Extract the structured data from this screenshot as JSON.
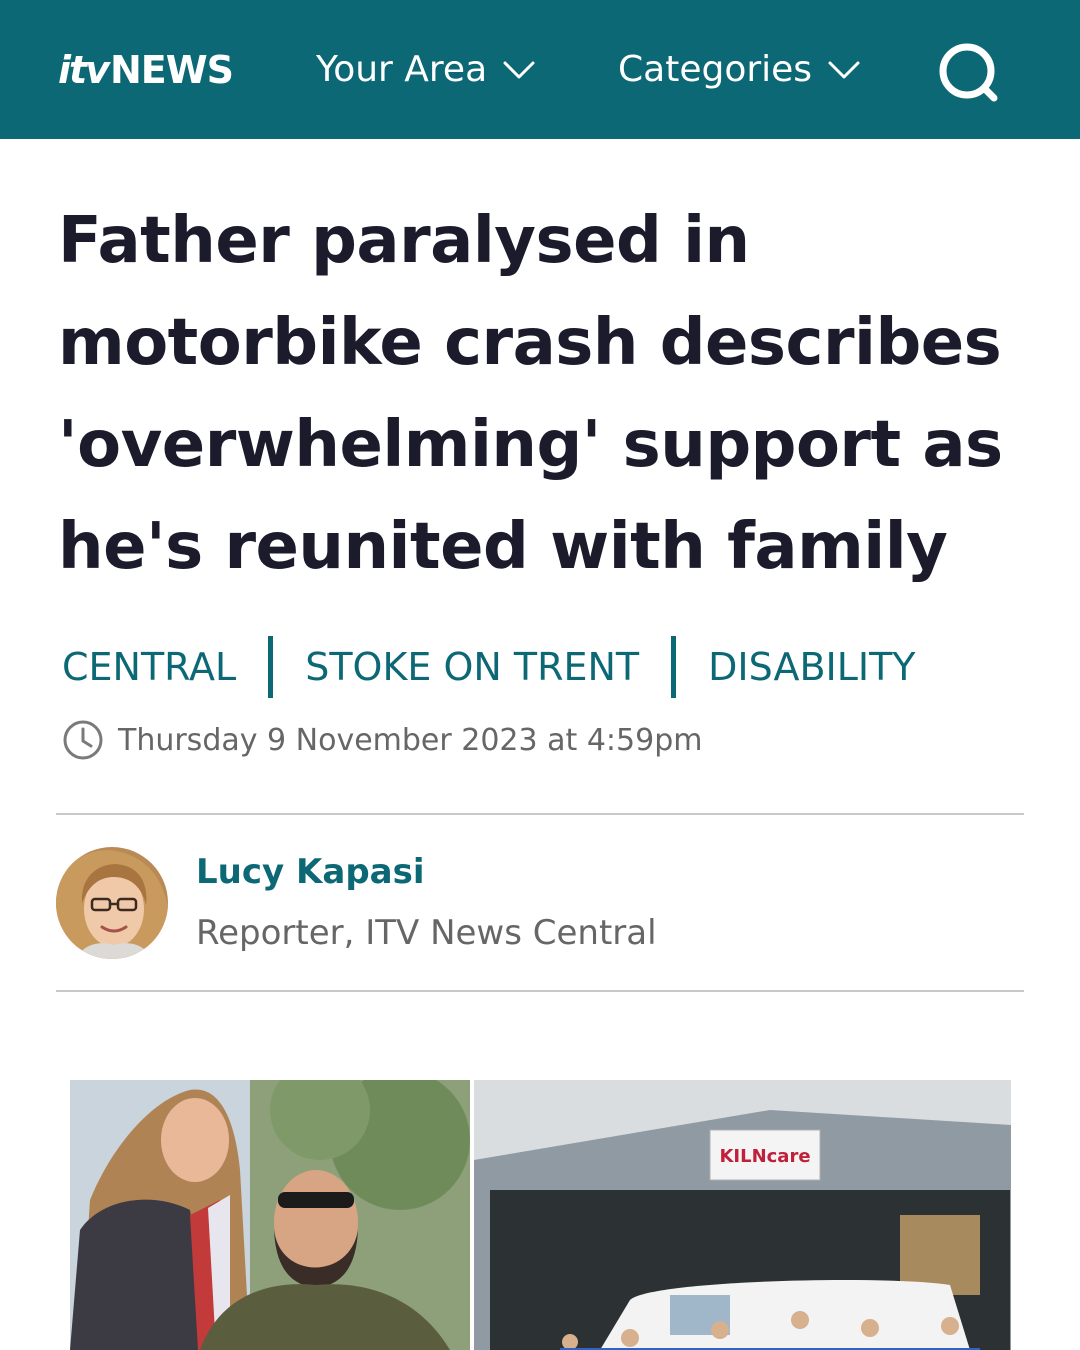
{
  "header": {
    "logo_prefix": "itv",
    "logo_suffix": "NEWS",
    "nav_your_area": "Your Area",
    "nav_categories": "Categories",
    "search_icon": "search-icon",
    "chevron_icon": "chevron-down-icon",
    "background_color": "#0d6876"
  },
  "article": {
    "headline": "Father paralysed in motorbike crash describes 'overwhelming' support as he's reunited with family",
    "tags": [
      "CENTRAL",
      "STOKE ON TRENT",
      "DISABILITY"
    ],
    "timestamp": "Thursday 9 November 2023 at 4:59pm",
    "clock_icon": "clock-icon",
    "author": {
      "name": "Lucy Kapasi",
      "role": "Reporter, ITV News Central"
    },
    "hero_image_sign": "KILNcare"
  },
  "colors": {
    "accent": "#0d6876",
    "text": "#1b1b2b",
    "muted": "#666666"
  }
}
